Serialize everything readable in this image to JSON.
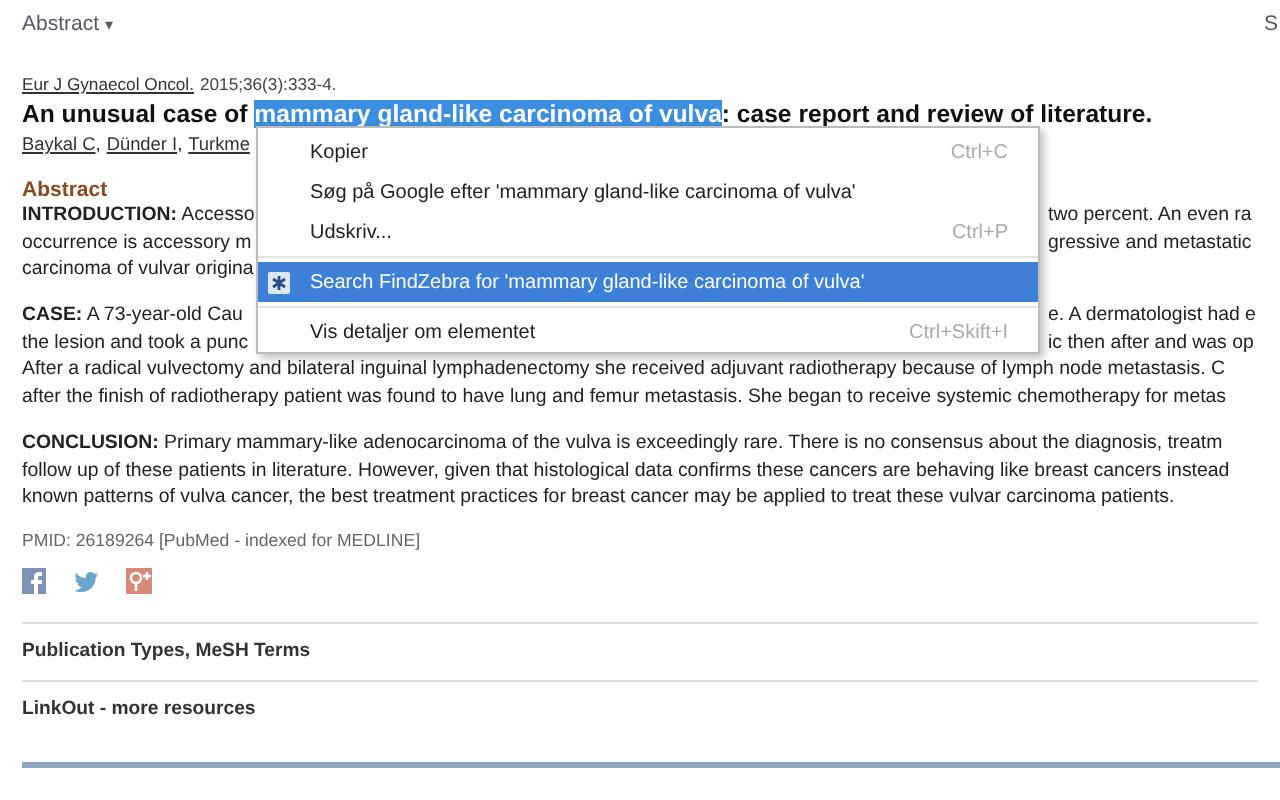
{
  "top_bar": {
    "format_menu": "Abstract",
    "caret": "▾",
    "right_cut": "S"
  },
  "citation": {
    "journal": "Eur J Gynaecol Oncol.",
    "details": "2015;36(3):333-4."
  },
  "title": {
    "before": "An unusual case of ",
    "selected_text": "mammary gland-like carcinoma of vulva",
    "after": ": case report and review of literature."
  },
  "authors": [
    {
      "name": "Baykal C",
      "separator": ","
    },
    {
      "name": "Dünder I",
      "separator": ","
    },
    {
      "name": "Turkme"
    }
  ],
  "abstract_heading": "Abstract",
  "paragraphs": [
    {
      "lines": [
        {
          "left": "**INTRODUCTION:** Accesso",
          "right": "two percent. An even ra"
        },
        {
          "left": "occurrence is accessory m",
          "right": "gressive and metastatic"
        },
        {
          "left": "carcinoma of vulvar origina"
        }
      ]
    },
    {
      "lines": [
        {
          "left": "**CASE:** A 73-year-old Cau",
          "right": "e. A dermatologist had e"
        },
        {
          "left": "the lesion and took a punc",
          "right": "ic then after and was op"
        },
        {
          "full": "After a radical vulvectomy and bilateral inguinal lymphadenectomy she received adjuvant radiotherapy because of lymph node metastasis. C"
        },
        {
          "full": "after the finish of radiotherapy patient was found to have lung and femur metastasis. She began to receive systemic chemotherapy for metas"
        }
      ]
    },
    {
      "lines": [
        {
          "full": "**CONCLUSION:** Primary mammary-like adenocarcinoma of the vulva is exceedingly rare. There is no consensus about the diagnosis, treatm"
        },
        {
          "full": "follow up of these patients in literature. However, given that histological data confirms these cancers are behaving like breast cancers instead"
        },
        {
          "full": "known patterns of vulva cancer, the best treatment practices for breast cancer may be applied to treat these vulvar carcinoma patients."
        }
      ]
    }
  ],
  "pmid": "PMID: 26189264 [PubMed - indexed for MEDLINE]",
  "share": [
    {
      "kind": "facebook"
    },
    {
      "kind": "twitter"
    },
    {
      "kind": "googleplus"
    }
  ],
  "sections": [
    "Publication Types, MeSH Terms",
    "LinkOut - more resources"
  ],
  "context_menu": [
    {
      "kind": "item",
      "label": "Kopier",
      "shortcut": "Ctrl+C",
      "selected": false
    },
    {
      "kind": "item",
      "label": "Søg på Google efter 'mammary gland-like carcinoma of vulva'",
      "selected": false
    },
    {
      "kind": "item",
      "label": "Udskriv...",
      "shortcut": "Ctrl+P",
      "selected": false
    },
    {
      "kind": "separator"
    },
    {
      "kind": "extension",
      "label": "Search FindZebra for 'mammary gland-like carcinoma of vulva'",
      "selected": true
    },
    {
      "kind": "separator"
    },
    {
      "kind": "item",
      "label": "Vis detaljer om elementet",
      "shortcut": "Ctrl+Skift+I",
      "selected": false
    }
  ]
}
